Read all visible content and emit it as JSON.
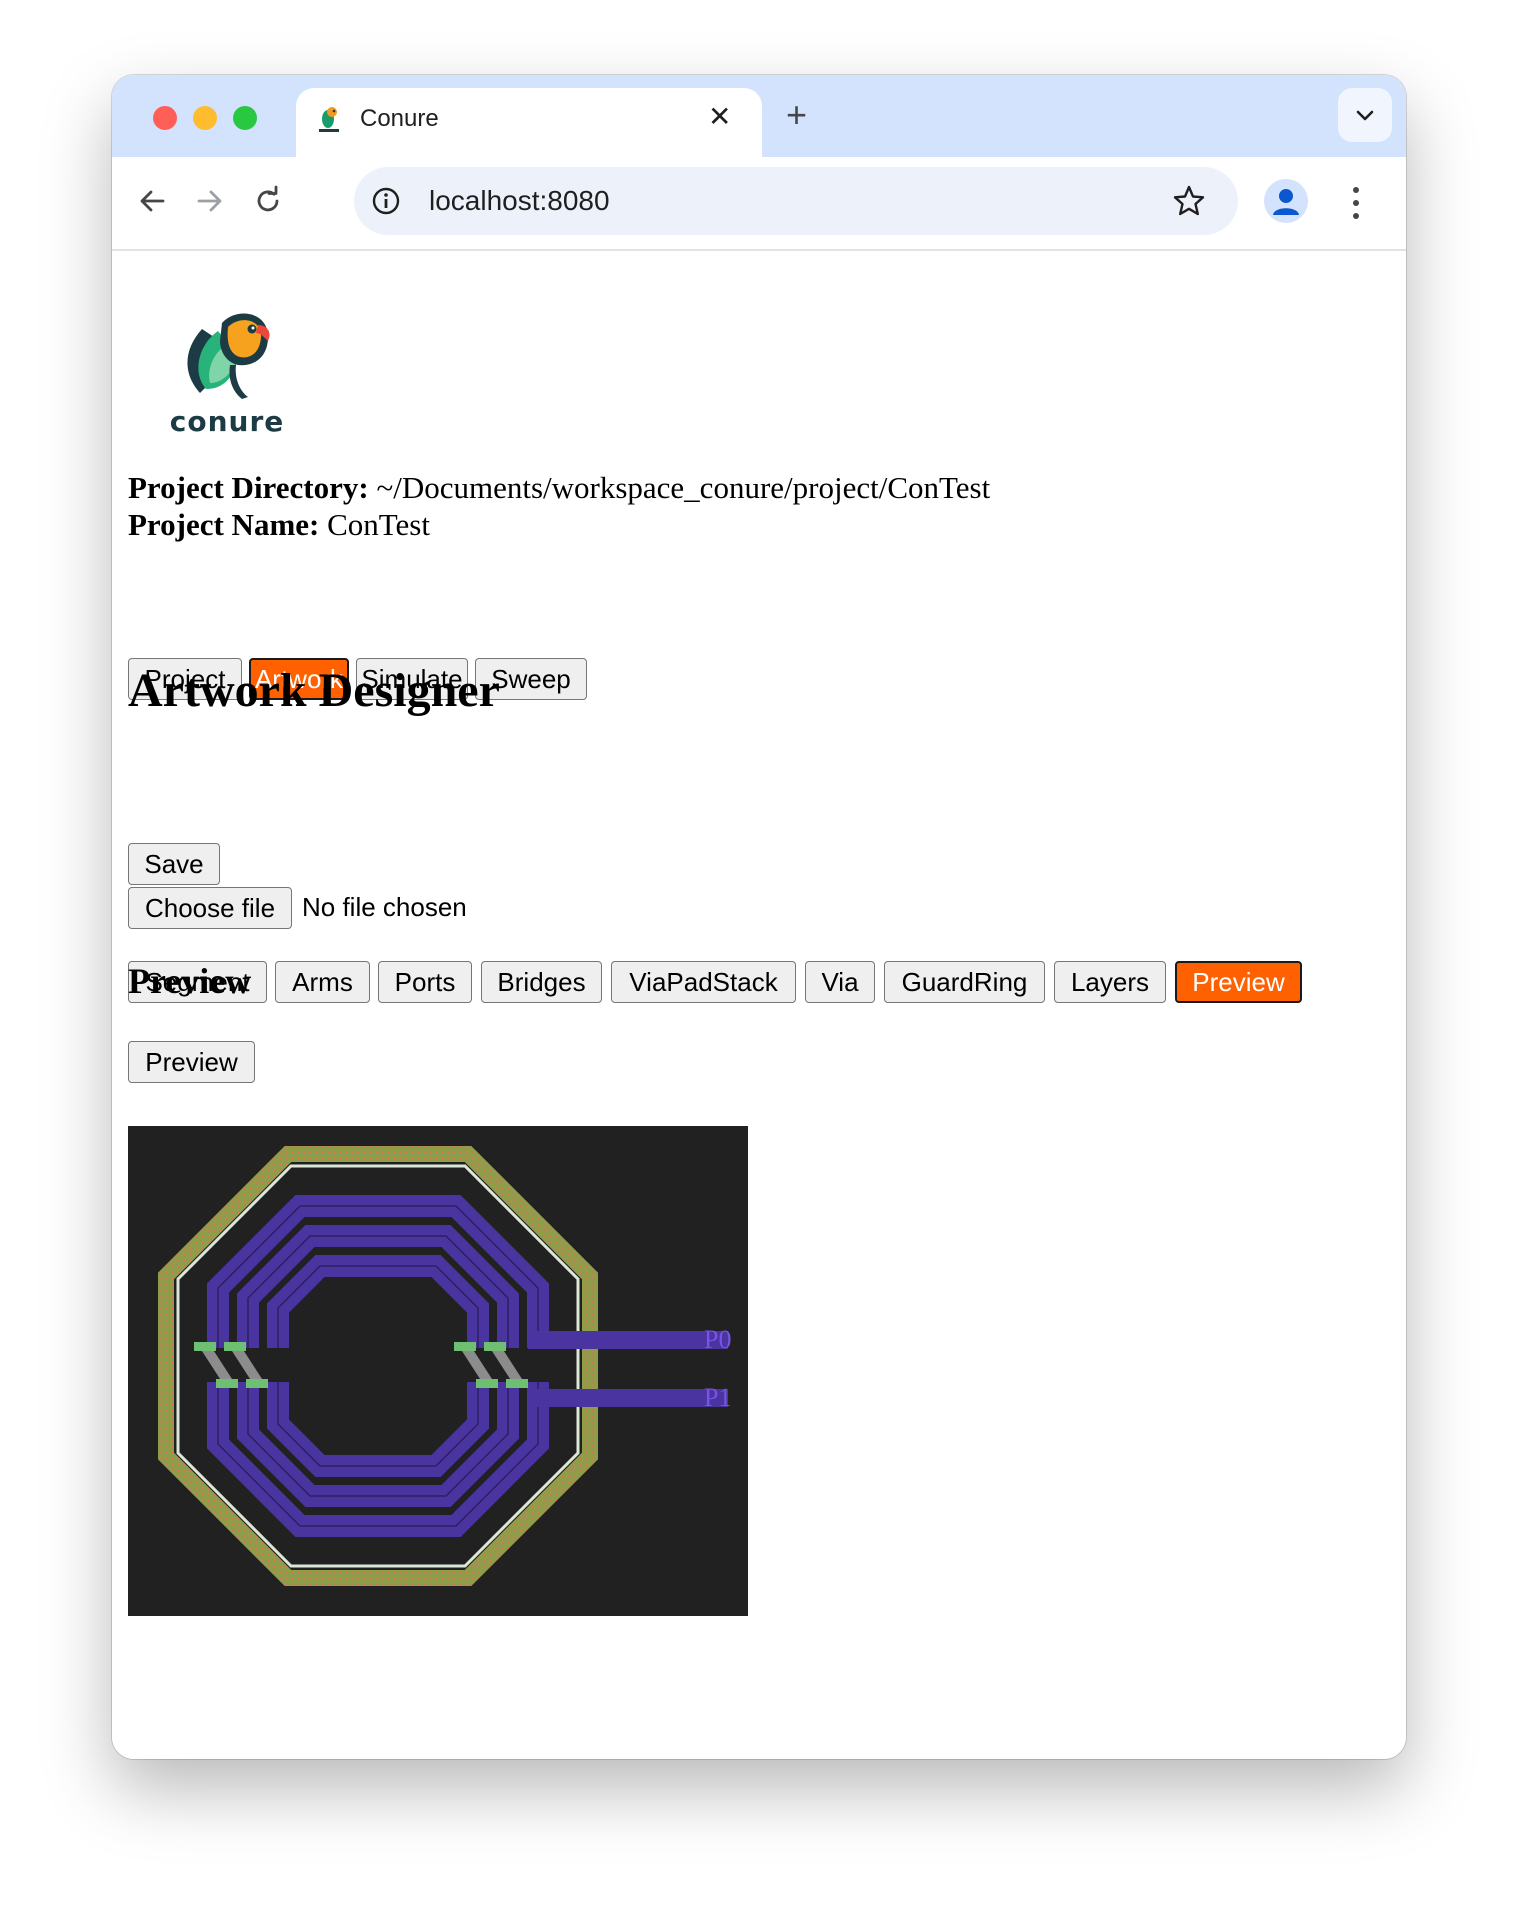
{
  "browser": {
    "tab_title": "Conure",
    "tab_close": "✕",
    "new_tab": "+",
    "url": "localhost:8080"
  },
  "logo": {
    "text": "conure"
  },
  "project": {
    "directory_label": "Project Directory:",
    "directory_value": "~/Documents/workspace_conure/project/ConTest",
    "name_label": "Project Name:",
    "name_value": "ConTest"
  },
  "main_tabs": [
    {
      "label": "Project",
      "active": false
    },
    {
      "label": "Artwork",
      "active": true
    },
    {
      "label": "Simulate",
      "active": false
    },
    {
      "label": "Sweep",
      "active": false
    }
  ],
  "page_title": "Artwork Designer",
  "save_label": "Save",
  "file_input": {
    "button_label": "Choose file",
    "status": "No file chosen"
  },
  "artwork_tabs": [
    {
      "label": "Segment",
      "active": false
    },
    {
      "label": "Arms",
      "active": false
    },
    {
      "label": "Ports",
      "active": false
    },
    {
      "label": "Bridges",
      "active": false
    },
    {
      "label": "ViaPadStack",
      "active": false
    },
    {
      "label": "Via",
      "active": false
    },
    {
      "label": "GuardRing",
      "active": false
    },
    {
      "label": "Layers",
      "active": false
    },
    {
      "label": "Preview",
      "active": true
    }
  ],
  "section_title": "Preview",
  "preview_button_label": "Preview",
  "preview": {
    "port_labels": [
      "P0",
      "P1"
    ],
    "colors": {
      "background": "#212121",
      "metal": "#4a34a0",
      "guard_ring": "#8fa048",
      "port_text": "#7a52e8",
      "bridge": "#6fbf73"
    }
  },
  "accent_color": "#ff6000"
}
